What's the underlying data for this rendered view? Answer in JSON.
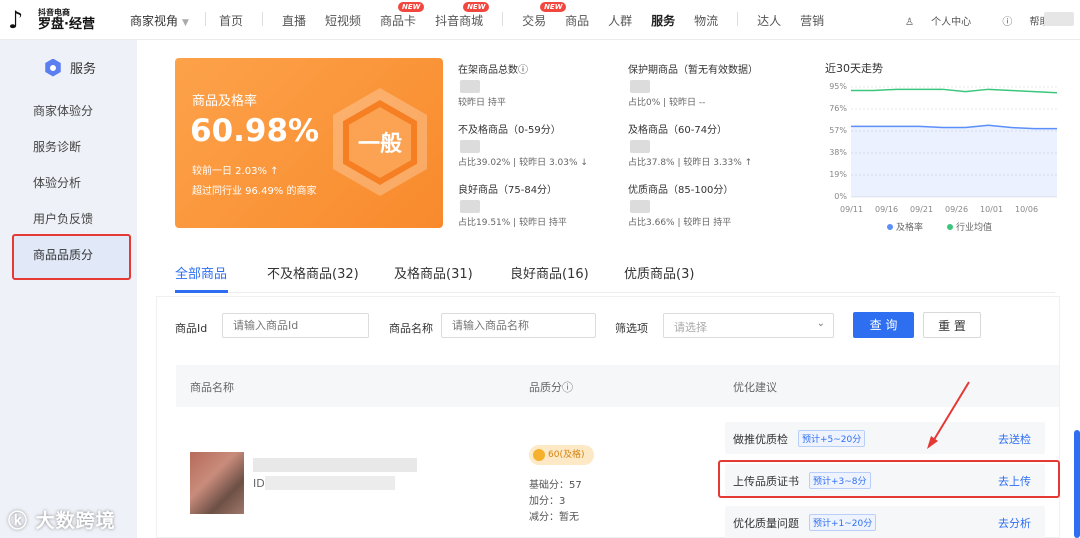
{
  "topbar": {
    "logo_small": "抖音电商",
    "logo_main": "罗盘·经营",
    "view": "商家视角",
    "nav": [
      {
        "label": "首页"
      },
      {
        "label": "直播"
      },
      {
        "label": "短视频"
      },
      {
        "label": "商品卡",
        "badge": "NEW"
      },
      {
        "label": "抖音商城",
        "badge": "NEW"
      },
      {
        "label": "交易",
        "badge": "NEW"
      },
      {
        "label": "商品"
      },
      {
        "label": "人群"
      },
      {
        "label": "服务"
      },
      {
        "label": "物流"
      },
      {
        "label": "达人"
      },
      {
        "label": "营销"
      }
    ],
    "personal": "个人中心",
    "help": "帮助"
  },
  "sidebar": {
    "title": "服务",
    "items": [
      "商家体验分",
      "服务诊断",
      "体验分析",
      "用户负反馈",
      "商品品质分"
    ]
  },
  "summary": {
    "title": "商品及格率",
    "rate": "60.98%",
    "vs_prev": "较前一日 2.03% ↑",
    "beyond": "超过同行业 96.49% 的商家",
    "level": "一般"
  },
  "stats": [
    {
      "label": "在架商品总数ⓘ",
      "sub1": "较昨日 持平"
    },
    {
      "label": "保护期商品（暂无有效数据）",
      "sub1": "占比0% | 较昨日 --"
    },
    {
      "label": "不及格商品（0-59分）",
      "sub1": "占比39.02% | 较昨日 ",
      "delta": "3.03% ↓",
      "dir": "down"
    },
    {
      "label": "及格商品（60-74分）",
      "sub1": "占比37.8% | 较昨日 ",
      "delta": "3.33% ↑",
      "dir": "up"
    },
    {
      "label": "良好商品（75-84分）",
      "sub1": "占比19.51% | 较昨日 持平"
    },
    {
      "label": "优质商品（85-100分）",
      "sub1": "占比3.66% | 较昨日 持平"
    }
  ],
  "chart_data": {
    "type": "line",
    "title": "近30天走势",
    "x": [
      "09/11",
      "09/16",
      "09/21",
      "09/26",
      "10/01",
      "10/06"
    ],
    "yticks": [
      "95%",
      "76%",
      "57%",
      "38%",
      "19%",
      "0%"
    ],
    "ylim": [
      0,
      95
    ],
    "series": [
      {
        "name": "及格率",
        "color": "#5b8ff9",
        "values": [
          61,
          61,
          61,
          61,
          60,
          60,
          62,
          60,
          59,
          59
        ]
      },
      {
        "name": "行业均值",
        "color": "#3cc67c",
        "values": [
          92,
          92,
          93,
          93,
          93,
          91,
          93,
          92,
          91,
          90
        ]
      }
    ],
    "legend": [
      "及格率",
      "行业均值"
    ]
  },
  "tabs": [
    "全部商品",
    "不及格商品(32)",
    "及格商品(31)",
    "良好商品(16)",
    "优质商品(3)"
  ],
  "filters": {
    "id_label": "商品Id",
    "id_ph": "请输入商品Id",
    "name_label": "商品名称",
    "name_ph": "请输入商品名称",
    "filter_label": "筛选项",
    "filter_ph": "请选择",
    "query": "查 询",
    "reset": "重 置"
  },
  "table": {
    "cols": [
      "商品名称",
      "品质分ⓘ",
      "优化建议"
    ],
    "row": {
      "id_prefix": "ID:",
      "score": "60(及格)",
      "base": "基础分：57",
      "plus": "加分：3",
      "minus": "减分：暂无",
      "suggestions": [
        {
          "text": "做推优质检",
          "tag": "预计+5~20分",
          "action": "去送检"
        },
        {
          "text": "上传品质证书",
          "tag": "预计+3~8分",
          "action": "去上传"
        },
        {
          "text": "优化质量问题",
          "tag": "预计+1~20分",
          "action": "去分析"
        }
      ]
    }
  },
  "watermark": "大数跨境"
}
